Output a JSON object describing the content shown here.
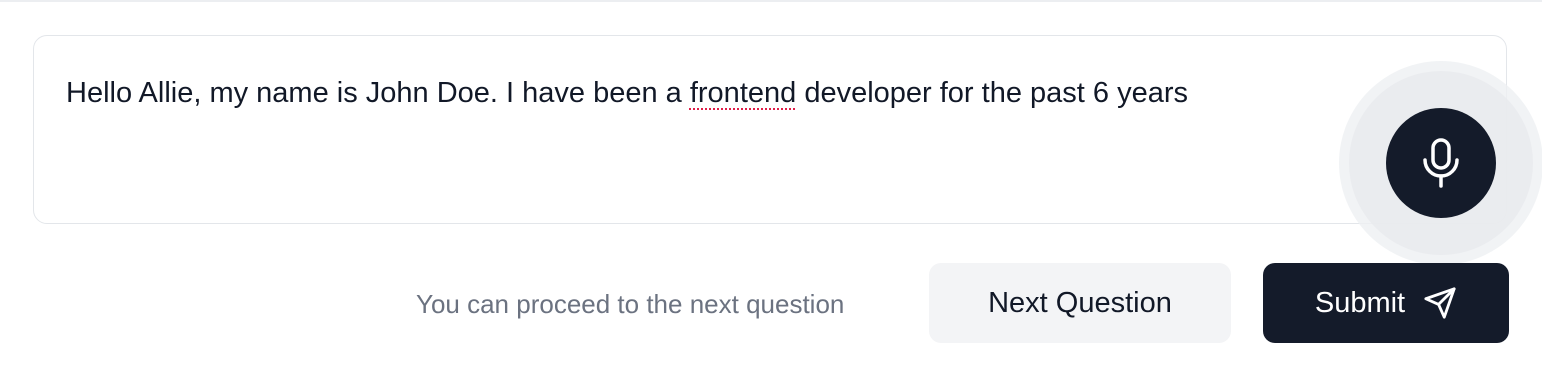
{
  "answer": {
    "text_before": "Hello Allie, my name is John Doe. I have been a ",
    "misspelled_word": "frontend",
    "text_after": " developer for the past 6 years"
  },
  "mic": {
    "icon": "microphone-icon"
  },
  "footer": {
    "hint": "You can proceed to the next question",
    "next_label": "Next Question",
    "submit_label": "Submit",
    "submit_icon": "send-icon"
  },
  "colors": {
    "primary_dark": "#141b2a",
    "secondary_bg": "#f3f4f6",
    "muted_text": "#6b7280",
    "spellcheck": "#e11d48"
  }
}
